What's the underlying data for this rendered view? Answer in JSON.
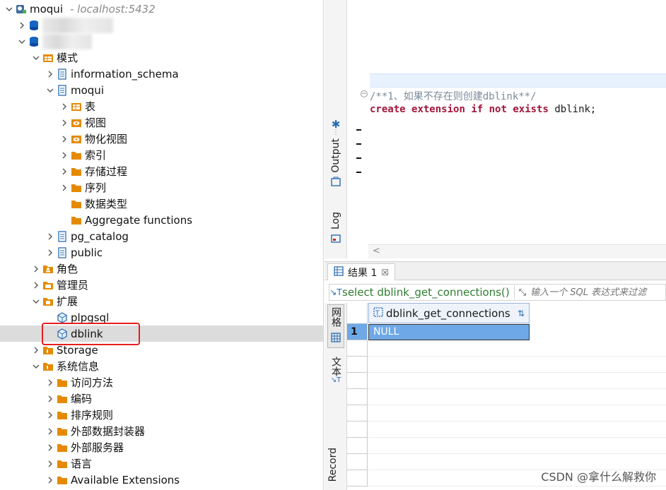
{
  "navigator": {
    "connection": {
      "name": "moqui",
      "host": "- localhost:5432"
    },
    "items": [
      {
        "label": "",
        "icon": "database-icon"
      },
      {
        "label": "",
        "icon": "database-icon"
      },
      {
        "label": "模式",
        "icon": "schemas-folder-icon"
      },
      {
        "label": "information_schema",
        "icon": "schema-icon"
      },
      {
        "label": "moqui",
        "icon": "schema-icon"
      },
      {
        "label": "表",
        "icon": "tables-folder-icon"
      },
      {
        "label": "视图",
        "icon": "views-folder-icon"
      },
      {
        "label": "物化视图",
        "icon": "views-folder-icon"
      },
      {
        "label": "索引",
        "icon": "folder-icon"
      },
      {
        "label": "存储过程",
        "icon": "folder-icon"
      },
      {
        "label": "序列",
        "icon": "folder-icon"
      },
      {
        "label": "数据类型",
        "icon": "folder-icon"
      },
      {
        "label": "Aggregate functions",
        "icon": "folder-icon"
      },
      {
        "label": "pg_catalog",
        "icon": "schema-icon"
      },
      {
        "label": "public",
        "icon": "schema-icon"
      },
      {
        "label": "角色",
        "icon": "roles-folder-icon"
      },
      {
        "label": "管理员",
        "icon": "admin-folder-icon"
      },
      {
        "label": "扩展",
        "icon": "extensions-folder-icon"
      },
      {
        "label": "plpgsql",
        "icon": "extension-icon"
      },
      {
        "label": "dblink",
        "icon": "extension-icon"
      },
      {
        "label": "Storage",
        "icon": "storage-folder-icon"
      },
      {
        "label": "系统信息",
        "icon": "system-folder-icon"
      },
      {
        "label": "访问方法",
        "icon": "folder-icon"
      },
      {
        "label": "编码",
        "icon": "folder-icon"
      },
      {
        "label": "排序规则",
        "icon": "folder-icon"
      },
      {
        "label": "外部数据封装器",
        "icon": "folder-icon"
      },
      {
        "label": "外部服务器",
        "icon": "folder-icon"
      },
      {
        "label": "语言",
        "icon": "folder-icon"
      },
      {
        "label": "Available Extensions",
        "icon": "folder-icon"
      }
    ]
  },
  "side_tabs": {
    "output": "Output",
    "log": "Log"
  },
  "editor": {
    "comment_line": "/**1、如果不存在则创建dblink**/",
    "kw1": "create",
    "kw2": "extension",
    "kw3": "if",
    "kw4": "not",
    "kw5": "exists",
    "ident": "dblink;"
  },
  "results": {
    "tab_label": "结果 1",
    "tab_close": "☒",
    "filter_query": "select dblink_get_connections()",
    "filter_placeholder": "输入一个 SQL 表达式来过滤",
    "grid_tab": "网格",
    "text_tab": "文本",
    "record_tab": "Record",
    "column_header": "dblink_get_connections",
    "row_number": "1",
    "cell_value": "NULL"
  },
  "watermark": "CSDN @拿什么解救你",
  "colors": {
    "selection": "#6fa8e6",
    "highlight_box": "#e81e1e",
    "folder": "#e58a00",
    "keyword": "#a3163a"
  }
}
